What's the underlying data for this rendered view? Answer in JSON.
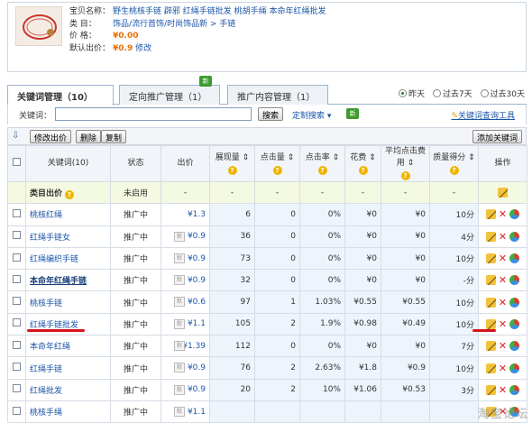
{
  "product": {
    "name_label": "宝贝名称：",
    "name_value": "野生桃核手链 辟邪 红绳手链批发 桃胡手绳 本命年红绳批发",
    "category_label": "类 目：",
    "category_value": "饰品/流行首饰/时尚饰品新 > 手链",
    "price_label": "价 格：",
    "price_value": "¥0.00",
    "default_bid_label": "默认出价：",
    "default_bid_value": "¥0.9",
    "edit_link": "修改"
  },
  "tabs": [
    {
      "label": "关键词管理（10）",
      "active": true
    },
    {
      "label": "定向推广管理（1）",
      "active": false,
      "badge": "新"
    },
    {
      "label": "推广内容管理（1）",
      "active": false
    }
  ],
  "period": {
    "options": [
      "昨天",
      "过去7天",
      "过去30天"
    ],
    "selected": "昨天"
  },
  "search": {
    "label": "关键词：",
    "value": "",
    "button": "搜索",
    "custom_search": "定制搜索",
    "badge": "新",
    "tool_link": "关键词查询工具"
  },
  "actions": {
    "modify_bid": "修改出价",
    "delete": "删除",
    "copy": "复制",
    "add_keyword": "添加关键词"
  },
  "columns": [
    "关键词(10)",
    "状态",
    "出价",
    "展现量",
    "点击量",
    "点击率",
    "花费",
    "平均点击费用",
    "质量得分",
    "操作"
  ],
  "category_row": {
    "label": "类目出价",
    "status": "未启用",
    "values": [
      "-",
      "-",
      "-",
      "-",
      "-",
      "-",
      "-"
    ]
  },
  "rows": [
    {
      "keyword": "桃核红绳",
      "status": "推广中",
      "bid": "¥1.3",
      "impressions": "6",
      "clicks": "0",
      "ctr": "0%",
      "cost": "¥0",
      "avg_cpc": "¥0",
      "quality": "10分"
    },
    {
      "keyword": "红绳手链女",
      "status": "推广中",
      "bid": "¥0.9",
      "impressions": "36",
      "clicks": "0",
      "ctr": "0%",
      "cost": "¥0",
      "avg_cpc": "¥0",
      "quality": "4分"
    },
    {
      "keyword": "红绳编织手链",
      "status": "推广中",
      "bid": "¥0.9",
      "impressions": "73",
      "clicks": "0",
      "ctr": "0%",
      "cost": "¥0",
      "avg_cpc": "¥0",
      "quality": "10分"
    },
    {
      "keyword": "本命年红绳手链",
      "status": "推广中",
      "bid": "¥0.9",
      "impressions": "32",
      "clicks": "0",
      "ctr": "0%",
      "cost": "¥0",
      "avg_cpc": "¥0",
      "quality": "-分"
    },
    {
      "keyword": "桃核手链",
      "status": "推广中",
      "bid": "¥0.6",
      "impressions": "97",
      "clicks": "1",
      "ctr": "1.03%",
      "cost": "¥0.55",
      "avg_cpc": "¥0.55",
      "quality": "10分"
    },
    {
      "keyword": "红绳手链批发",
      "status": "推广中",
      "bid": "¥1.1",
      "impressions": "105",
      "clicks": "2",
      "ctr": "1.9%",
      "cost": "¥0.98",
      "avg_cpc": "¥0.49",
      "quality": "10分"
    },
    {
      "keyword": "本命年红绳",
      "status": "推广中",
      "bid": "¥1.39",
      "impressions": "112",
      "clicks": "0",
      "ctr": "0%",
      "cost": "¥0",
      "avg_cpc": "¥0",
      "quality": "7分"
    },
    {
      "keyword": "红绳手链",
      "status": "推广中",
      "bid": "¥0.9",
      "impressions": "76",
      "clicks": "2",
      "ctr": "2.63%",
      "cost": "¥1.8",
      "avg_cpc": "¥0.9",
      "quality": "10分"
    },
    {
      "keyword": "红绳批发",
      "status": "推广中",
      "bid": "¥0.9",
      "impressions": "20",
      "clicks": "2",
      "ctr": "10%",
      "cost": "¥1.06",
      "avg_cpc": "¥0.53",
      "quality": "3分"
    },
    {
      "keyword": "桃核手绳",
      "status": "推广中",
      "bid": "¥1.1",
      "impressions": "",
      "clicks": "",
      "ctr": "",
      "cost": "",
      "avg_cpc": "",
      "quality": ""
    }
  ],
  "watermark": "淘宝论坛",
  "colors": {
    "link": "#1a55a8",
    "price": "#e8700a",
    "highlight": "#d4141b",
    "new_badge": "#3d9a2e"
  }
}
